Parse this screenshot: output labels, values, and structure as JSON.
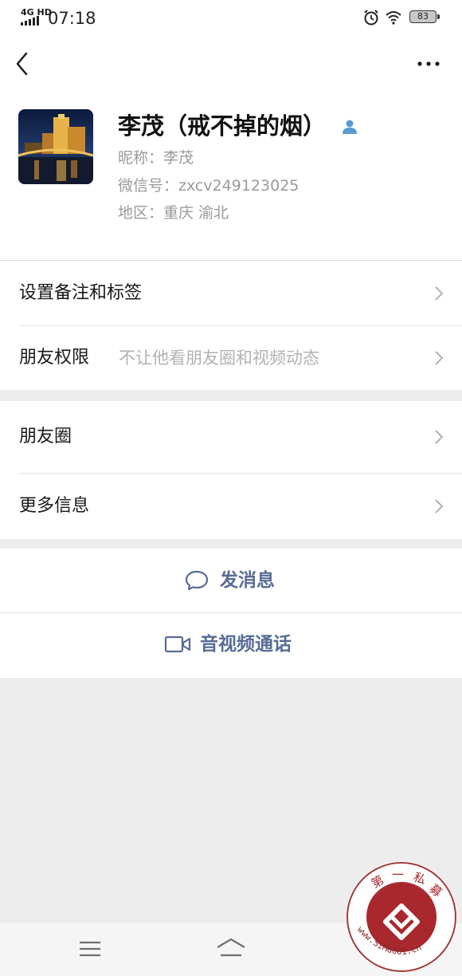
{
  "status_bar": {
    "network": "4G HD",
    "time": "07:18",
    "battery": "83"
  },
  "profile": {
    "name": "李茂（戒不掉的烟）",
    "nickname": "昵称：李茂",
    "wechat_id": "微信号：zxcv249123025",
    "region": "地区：重庆  渝北"
  },
  "settings": {
    "remark_tags": "设置备注和标签",
    "friend_permission": "朋友权限",
    "friend_permission_value": "不让他看朋友圈和视频动态"
  },
  "sections": {
    "moments": "朋友圈",
    "more_info": "更多信息"
  },
  "actions": {
    "send_message": "发消息",
    "av_call": "音视频通话"
  },
  "watermark": {
    "text_top": "第 一 私 募",
    "text_bottom": "www.SiMu001.cn"
  },
  "colors": {
    "accent_link": "#576b95",
    "background": "#ededed",
    "friend_icon": "#5b9bd5"
  }
}
